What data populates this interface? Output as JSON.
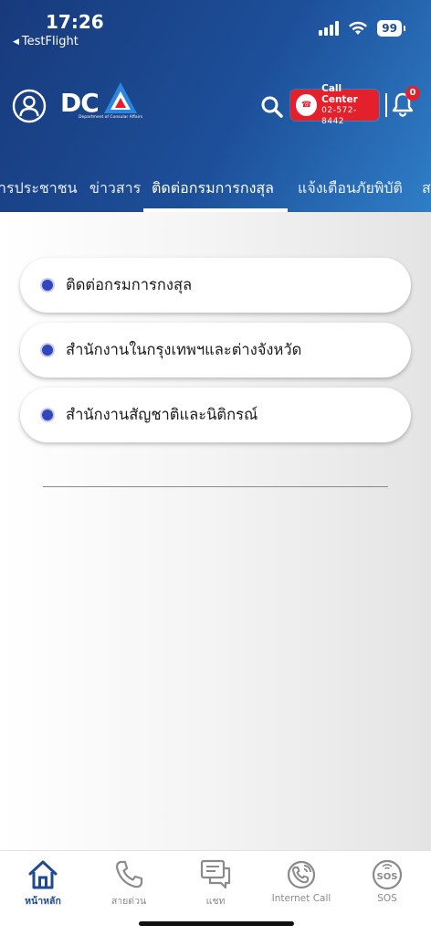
{
  "status_bar": {
    "time": "17:26",
    "back_label": "TestFlight",
    "battery": "99"
  },
  "header": {
    "logo_text": "DC",
    "logo_subtitle": "Department of Consular Affairs",
    "call_center_title": "Call Center",
    "call_center_phone": "02-572-8442",
    "notification_count": "0"
  },
  "tabs": [
    {
      "label": "ารประชาชน"
    },
    {
      "label": "ข่าวสาร"
    },
    {
      "label": "ติดต่อกรมการกงสุล"
    },
    {
      "label": "แจ้งเตือนภัยพิบัติ"
    },
    {
      "label": "ส"
    }
  ],
  "menu": {
    "items": [
      {
        "label": "ติดต่อกรมการกงสุล"
      },
      {
        "label": "สำนักงานในกรุงเทพฯและต่างจังหวัด"
      },
      {
        "label": "สำนักงานสัญชาติและนิติกรณ์"
      }
    ]
  },
  "bottom_nav": [
    {
      "label": "หน้าหลัก"
    },
    {
      "label": "สายด่วน"
    },
    {
      "label": "แชท"
    },
    {
      "label": "Internet Call"
    },
    {
      "label": "SOS"
    }
  ],
  "colors": {
    "header_dark": "#183a7c",
    "header_light": "#2f7ec7",
    "accent_red": "#e3202c",
    "bullet_blue": "#3347b8",
    "nav_active": "#1d4a90"
  }
}
